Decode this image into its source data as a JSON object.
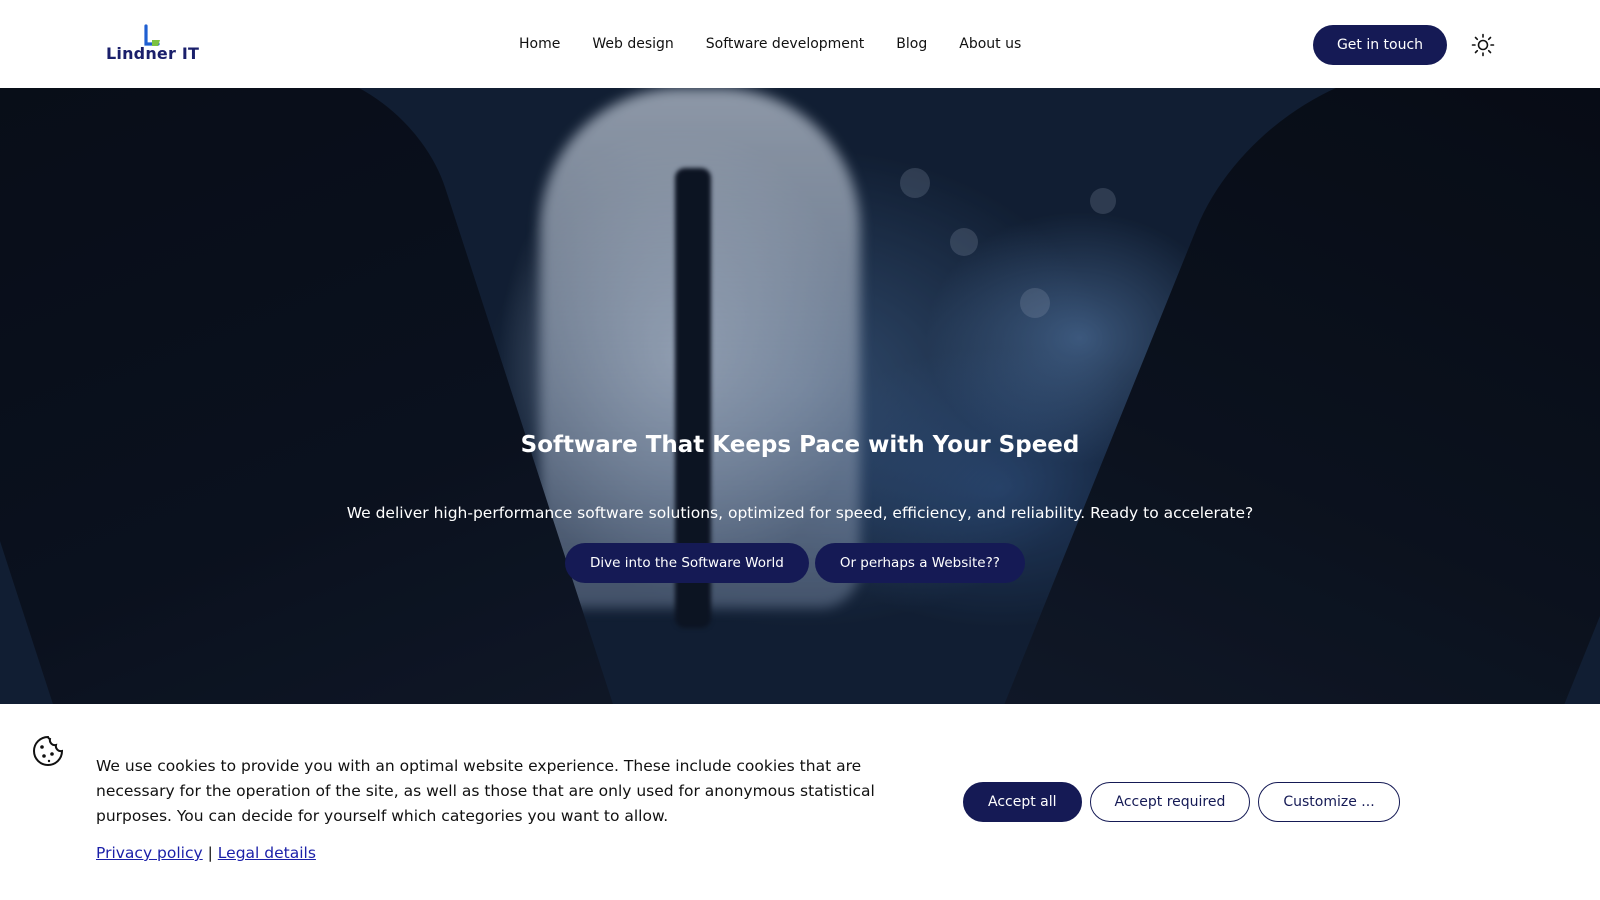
{
  "header": {
    "logo_text": "Lindner IT",
    "nav": [
      "Home",
      "Web design",
      "Software development",
      "Blog",
      "About us"
    ],
    "cta_label": "Get in touch",
    "theme_icon": "sun-icon"
  },
  "hero": {
    "title": "Software That Keeps Pace with Your Speed",
    "subtitle": "We deliver high-performance software solutions, optimized for speed, efficiency, and reliability. Ready to accelerate?",
    "buttons": [
      "Dive into the Software World",
      "Or perhaps a Website??"
    ]
  },
  "cookie_banner": {
    "icon": "cookie-icon",
    "text": "We use cookies to provide you with an optimal website experience. These include cookies that are necessary for the operation of the site, as well as those that are only used for anonymous statistical purposes. You can decide for yourself which categories you want to allow.",
    "links": [
      "Privacy policy",
      "Legal details"
    ],
    "separator": "|",
    "buttons": {
      "accept_all": "Accept all",
      "accept_required": "Accept required",
      "customize": "Customize ..."
    }
  },
  "colors": {
    "brand_navy": "#151a55",
    "link_blue": "#1a1fa8",
    "logo_accent_green": "#7cc242",
    "logo_accent_blue": "#1f5fd1"
  }
}
